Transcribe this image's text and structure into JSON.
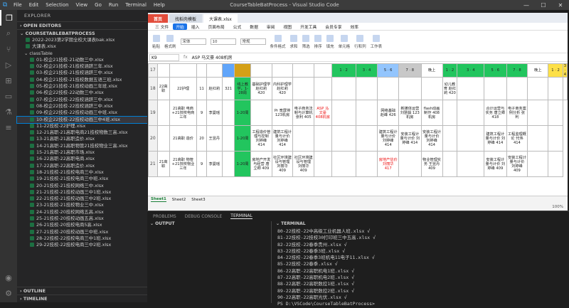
{
  "window": {
    "title": "CourseTableBatProcess - Visual Studio Code",
    "menus": [
      "File",
      "Edit",
      "Selection",
      "View",
      "Go",
      "Run",
      "Terminal",
      "Help"
    ]
  },
  "sidebar": {
    "title": "EXPLORER",
    "open_editors": "OPEN EDITORS",
    "project": "COURSETABLEBATPROCESS",
    "root_files": [
      "2022-2023第2学期全校大课表bak.xlsx",
      "大课表.xlsx"
    ],
    "folder": "classTable",
    "files": [
      "01-校企21技校-21动数三中.xlsx",
      "02-校企21技校-21技校涵跻三年.xlsx",
      "03-校企21技校-21技校涵跻三中.xlsx",
      "04-校企21技校-21技校数据五语三班.xlsx",
      "05-校企21技校-21技校动画三年班.xlsx",
      "06-校企22技校-22动数三中.xlsx",
      "07-校企22技校-22技校涵跻三中.xlsx",
      "08-校企22技校-22技校涵跻三中.xlsx",
      "09-校企22技校-22技校动画三中班.xlsx",
      "10-校企22技校-22技校动画三中4班.xlsx",
      "11-22技校-22护理.xlsx",
      "12-21高职-21高职电商21技校物数三高.xlsx",
      "13-21高职-21高职造价.xlsx",
      "14-21高职-21高职物管21技校物业三高.xlsx",
      "15-21高职-21高职市场.xlsx",
      "16-22高职-22高职电商.xlsx",
      "17-22高职-22高职造价.xlsx",
      "18-21技校-21技校电商三中.xlsx",
      "19-21技校-21技校电商三中班.xlsx",
      "20-21技校-21技校网络三中.xlsx",
      "21-21技校-21技校动画三中1班.xlsx",
      "22-21技校-21技校动画三中2班.xlsx",
      "23-21技校-21技校物业三中.xlsx",
      "24-21技校-20技校网络五高.xlsx",
      "25-21技校-20技校动画五高.xlsx",
      "26-21技校-20技校电商5高.xlsx",
      "27-21技校-20技校动画三中班.xlsx",
      "28-22技校-22技校电商三中1班.xlsx",
      "29-22技校-22技校电商三中2班.xlsx"
    ],
    "outline": "OUTLINE",
    "timeline": "TIMELINE"
  },
  "wps": {
    "tabs": [
      "首页",
      "找稻壳模板",
      "大课表.xlsx"
    ],
    "menus": [
      "三 文件",
      "开始",
      "插入",
      "页面布局",
      "公式",
      "数据",
      "审阅",
      "视图",
      "开发工具",
      "会员专享",
      "效率"
    ],
    "ribbon": [
      "粘贴",
      "格式刷",
      "宋体",
      "10",
      "常规",
      "条件格式",
      "求和",
      "筛选",
      "排序",
      "填充",
      "单元格",
      "行和列",
      "工作表"
    ],
    "cellref": "K9",
    "formula": "ASP 马文豪 408机房",
    "sheets": [
      "Sheet1",
      "Sheet2",
      "Sheet3"
    ],
    "zoom": "100%"
  },
  "grid": {
    "rows": [
      "17",
      "18",
      "19",
      "20",
      "21"
    ],
    "r17": [
      "",
      "",
      "",
      "",
      "",
      "",
      "",
      "",
      "",
      "",
      "1 · 2",
      "3 · 4",
      "5 · 6",
      "7 · 8",
      "晚上",
      "1 · 2",
      "3 · 4",
      "5 · 6",
      "7 · 8",
      "晚上",
      "1 · 2",
      "3 · 4"
    ],
    "r18": [
      "22高职",
      "22护理",
      "11",
      "赵红莉",
      "321",
      "线上教学，1-28周",
      "基础护理学 赵红莉 420",
      "内科护理学 赵红莉 420",
      "",
      "",
      "",
      "",
      "",
      "",
      "",
      "幼儿教育 赵红莉 420",
      "",
      "",
      "",
      "",
      "",
      ""
    ],
    "r19": [
      "",
      "21高职 电商+21技校电商三年",
      "9",
      "李曼瑶",
      "",
      "1-20周",
      "",
      "Pr 宽屏排 123机房",
      "电子商务法制与计算机 张利 405",
      "ASP 马文豪 408机房",
      "",
      "",
      "网络基础 赵峰 426",
      "新媒体运营 刘慧娟 123机房",
      "flash动画制作 408机房",
      "",
      "",
      "合计运营与实务 唐立卿 418",
      "电子商务案例分析 张利",
      "",
      ""
    ],
    "r20": [
      "",
      "21高职 造价",
      "20",
      "王昱丹",
      "",
      "1-20周",
      "工程造价管理与控制 刘婷峰 414",
      "建筑工程计量与计价 刘婷峰 414",
      "",
      "",
      "",
      "",
      "建筑工程计量与计价 刘婷峰 414",
      "安装工程计量与计价 刘婷峰 414",
      "安装工程计量与计价 刘婷峰 414",
      "",
      "",
      "建筑工程计量与计价 刘婷峰 414",
      "工程监理概论 代伟 414",
      "",
      ""
    ],
    "r21": [
      "21高职",
      "21高职 物管+21技校物业三年",
      "9",
      "李曼瑶",
      "",
      "1-20周",
      "房地产开发与经营 唐立卿 409",
      "社区环境建设与管理 刘丽华 409",
      "社区环境建设与管理 刘丽华 409",
      "",
      "",
      "",
      "房地产估价 刘丽华 417",
      "",
      "物业管理实务 王昱丹 409",
      "",
      "",
      "安装工程计量与计价 刘婷峰 409",
      "安装工程计量与计价 刘婷峰 409",
      "",
      ""
    ]
  },
  "panel": {
    "tabs": [
      "PROBLEMS",
      "DEBUG CONSOLE",
      "TERMINAL"
    ],
    "output": "OUTPUT",
    "terminal": "TERMINAL",
    "lines": [
      "80-22技校-22中高级工业机器人班.xlsx √",
      "81-22技校-22技校30打印班三中五高.xlsx √",
      "82-22技校-22春季贵州.xlsx √",
      "83-22技校-22春季3班.xlsx √",
      "84-22技校-22春季3班机电11电子11.xlsx √",
      "85-22技校-22春季.xlsx √",
      "86-22高职-22高职机电1班.xlsx √",
      "87-22高职-22高职机电2班.xlsx √",
      "88-22高职-22高职数控1班.xlsx √",
      "89-22高职-22高职数控2班.xlsx √",
      "90-22高职-22高职光伏.xlsx √",
      "PS D:\\VSCode\\CourseTableBatProcess> "
    ]
  }
}
